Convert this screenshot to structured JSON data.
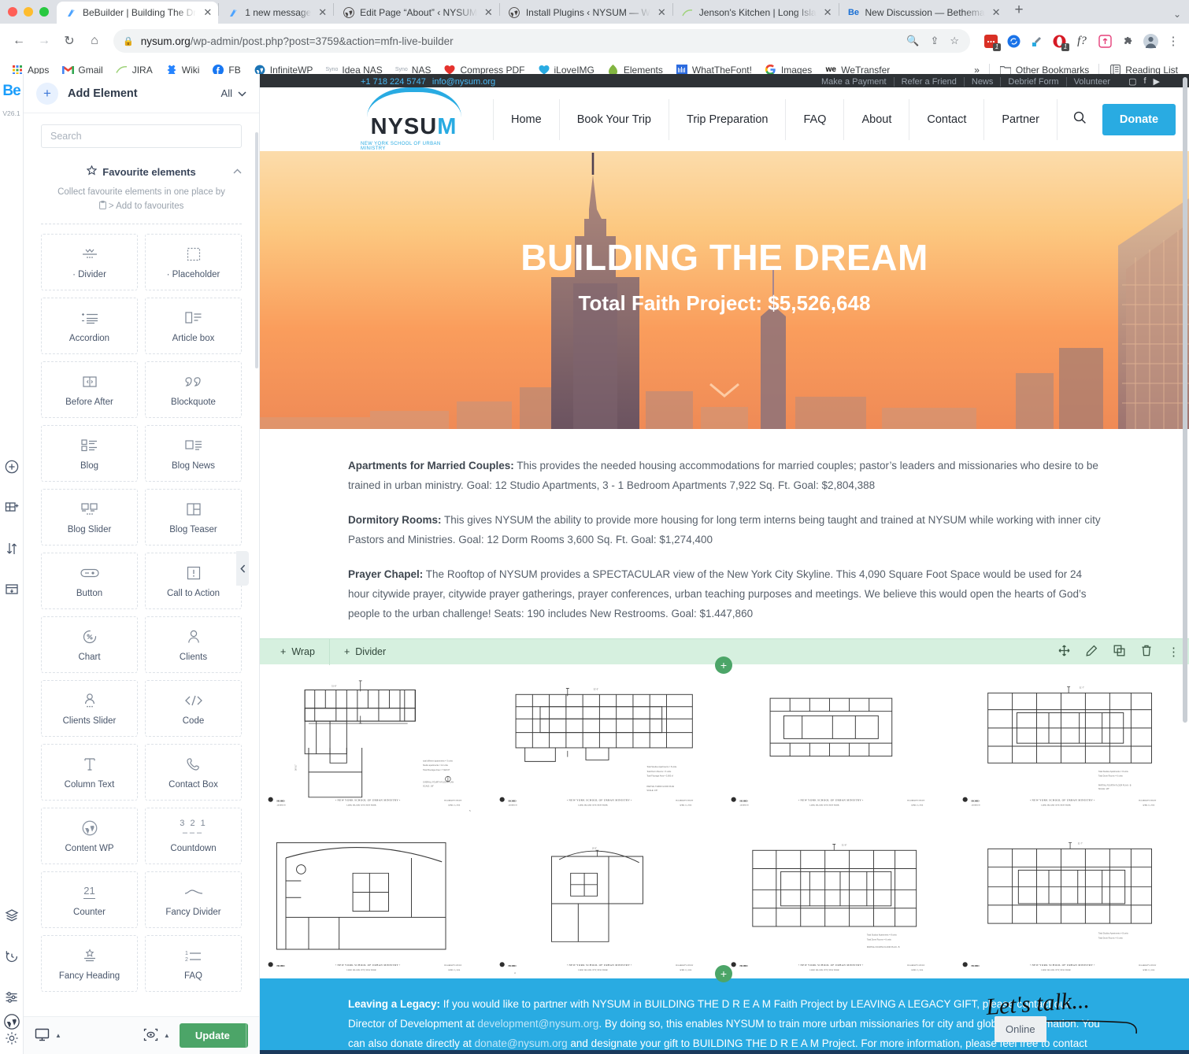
{
  "browser": {
    "tabs": [
      {
        "title": "BeBuilder | Building The Dr",
        "icon": "bebuilder-icon",
        "active": true
      },
      {
        "title": "1 new message",
        "icon": "bebuilder-icon",
        "active": false
      },
      {
        "title": "Edit Page “About” ‹ NYSUM",
        "icon": "wordpress-icon",
        "active": false
      },
      {
        "title": "Install Plugins ‹ NYSUM — W",
        "icon": "wordpress-icon",
        "active": false
      },
      {
        "title": "Jenson's Kitchen | Long Isla",
        "icon": "jira-icon",
        "active": false
      },
      {
        "title": "New Discussion — Bethema",
        "icon": "be-icon",
        "active": false
      }
    ],
    "new_tab_label": "+",
    "tab_list_chevron": "⌄",
    "url_host": "nysum.org",
    "url_path": "/wp-admin/post.php?post=3759&action=mfn-live-builder",
    "omnibox_icons": [
      "zoom-out-icon",
      "share-icon",
      "bookmark-star-icon"
    ],
    "extensions": [
      {
        "name": "screencast-extension-icon",
        "badge": "1"
      },
      {
        "name": "sync-extension-icon",
        "badge": ""
      },
      {
        "name": "eyedropper-extension-icon",
        "badge": ""
      },
      {
        "name": "opera-extension-icon",
        "badge": "1"
      },
      {
        "name": "whatthefont-extension-icon",
        "badge": ""
      },
      {
        "name": "upload-extension-icon",
        "badge": ""
      },
      {
        "name": "puzzle-extensions-icon",
        "badge": ""
      },
      {
        "name": "profile-avatar",
        "badge": ""
      },
      {
        "name": "chrome-menu-icon",
        "badge": ""
      }
    ],
    "bookmarks": [
      {
        "label": "Apps",
        "icon": "apps-grid-icon"
      },
      {
        "label": "Gmail",
        "icon": "gmail-icon"
      },
      {
        "label": "JIRA",
        "icon": "jira-icon"
      },
      {
        "label": "Wiki",
        "icon": "wiki-icon"
      },
      {
        "label": "FB",
        "icon": "facebook-icon"
      },
      {
        "label": "InfiniteWP",
        "icon": "wordpress-icon"
      },
      {
        "label": "Idea NAS",
        "icon": "synology-icon"
      },
      {
        "label": "NAS",
        "icon": "synology-icon"
      },
      {
        "label": "Compress PDF",
        "icon": "ilovepdf-icon"
      },
      {
        "label": "iLoveIMG",
        "icon": "iloveimg-icon"
      },
      {
        "label": "Elements",
        "icon": "envato-icon"
      },
      {
        "label": "WhatTheFont!",
        "icon": "whatthefont-icon"
      },
      {
        "label": "Images",
        "icon": "google-icon"
      },
      {
        "label": "WeTransfer",
        "icon": "wetransfer-icon"
      }
    ],
    "overflow_label": "»",
    "other_bookmarks": "Other Bookmarks",
    "reading_list": "Reading List"
  },
  "rail": {
    "logo": "Be",
    "version": "V26.1",
    "icons_top": [
      "add-circle-icon",
      "add-section-icon",
      "reorder-icon",
      "add-row-icon"
    ],
    "icons_bottom": [
      "layers-icon",
      "history-icon",
      "sliders-icon",
      "gear-icon"
    ],
    "wordpress_icon": "wordpress-icon"
  },
  "sidebar": {
    "add_element_label": "Add Element",
    "filter_label": "All",
    "filter_chevron": "⌄",
    "search_placeholder": "Search",
    "favourites_title": "Favourite elements",
    "favourites_desc_line1": "Collect favourite elements in one place by",
    "favourites_desc_line2": "> Add to favourites",
    "elements": [
      {
        "label": "· Divider",
        "icon": "divider-icon"
      },
      {
        "label": "· Placeholder",
        "icon": "placeholder-icon"
      },
      {
        "label": "Accordion",
        "icon": "accordion-icon"
      },
      {
        "label": "Article box",
        "icon": "article-box-icon"
      },
      {
        "label": "Before After",
        "icon": "before-after-icon"
      },
      {
        "label": "Blockquote",
        "icon": "blockquote-icon"
      },
      {
        "label": "Blog",
        "icon": "blog-icon"
      },
      {
        "label": "Blog News",
        "icon": "blog-news-icon"
      },
      {
        "label": "Blog Slider",
        "icon": "blog-slider-icon"
      },
      {
        "label": "Blog Teaser",
        "icon": "blog-teaser-icon"
      },
      {
        "label": "Button",
        "icon": "button-icon"
      },
      {
        "label": "Call to Action",
        "icon": "call-to-action-icon"
      },
      {
        "label": "Chart",
        "icon": "chart-icon"
      },
      {
        "label": "Clients",
        "icon": "clients-icon"
      },
      {
        "label": "Clients Slider",
        "icon": "clients-slider-icon"
      },
      {
        "label": "Code",
        "icon": "code-icon"
      },
      {
        "label": "Column Text",
        "icon": "column-text-icon"
      },
      {
        "label": "Contact Box",
        "icon": "contact-box-icon"
      },
      {
        "label": "Content WP",
        "icon": "wordpress-icon"
      },
      {
        "label": "Countdown",
        "icon": "countdown-icon"
      },
      {
        "label": "Counter",
        "icon": "counter-icon"
      },
      {
        "label": "Fancy Divider",
        "icon": "fancy-divider-icon"
      },
      {
        "label": "Fancy Heading",
        "icon": "fancy-heading-icon"
      },
      {
        "label": "FAQ",
        "icon": "faq-icon"
      }
    ],
    "footer": {
      "device_icon": "desktop-icon",
      "preview_icon": "preview-eye-icon",
      "update_label": "Update",
      "update_caret": "▲"
    },
    "collapse_icon": "chevron-left-icon"
  },
  "site": {
    "topbar": {
      "phone": "+1 718 224 5747",
      "email": "info@nysum.org",
      "links": [
        "Make a Payment",
        "Refer a Friend",
        "News",
        "Debrief Form",
        "Volunteer"
      ],
      "social": [
        "instagram-icon",
        "facebook-icon",
        "youtube-icon",
        "twitter-icon"
      ]
    },
    "logo_name": "NYSU",
    "logo_name_accent": "M",
    "logo_tagline": "NEW YORK SCHOOL OF URBAN MINISTRY",
    "nav": [
      "Home",
      "Book Your Trip",
      "Trip Preparation",
      "FAQ",
      "About",
      "Contact",
      "Partner"
    ],
    "search_icon": "search-icon",
    "donate_label": "Donate",
    "hero_title": "BUILDING THE DREAM",
    "hero_subtitle": "Total Faith Project: $5,526,648",
    "hero_scroll_icon": "chevron-down-icon",
    "paragraphs": [
      {
        "heading": "Apartments for Married Couples:",
        "body": "  This provides the needed housing accommodations for married couples; pastor’s leaders and missionaries who desire to be trained in urban ministry.  Goal: 12 Studio Apartments, 3 - 1 Bedroom Apartments 7,922 Sq. Ft.  Goal: $2,804,388"
      },
      {
        "heading": "Dormitory Rooms:",
        "body": "  This gives NYSUM the ability to provide more housing for long term interns being taught and trained at NYSUM while working with inner city Pastors and Ministries. Goal:  12 Dorm Rooms 3,600 Sq. Ft. Goal: $1,274,400"
      },
      {
        "heading": "Prayer Chapel:",
        "body": "  The Rooftop of NYSUM provides a SPECTACULAR view of the New York City Skyline.  This 4,090 Square Foot Space would be used for 24 hour citywide prayer, citywide prayer gatherings, prayer conferences, urban teaching purposes and meetings.  We believe this would open the hearts of God’s people to the urban challenge! Seats: 190 includes New Restrooms. Goal:  $1.447,860"
      }
    ],
    "footer": {
      "heading": "Leaving a Legacy:",
      "line1": "  If you would like to partner with NYSUM in BUILDING THE D R E A M Faith Project by LEAVING A LEGACY GIFT, please contact our Director of",
      "line2_pre": "Development at ",
      "email1": "development@nysum.org",
      "line2_post": ".  By doing so, this enables NYSUM to train more urban missionaries for city and global transformation.  You can also donate",
      "line3_pre": "directly at ",
      "email2": "donate@nysum.org",
      "line3_post": " and designate your gift to BUILDING THE D R E A M Project.  For more information, please feel free to contact ",
      "chat_label": "Let's talk...",
      "chat_status": "Online"
    }
  },
  "builder_toolbar": {
    "wrap_label": "Wrap",
    "divider_label": "Divider",
    "plus_icon": "+",
    "actions": [
      "move-icon",
      "edit-pencil-icon",
      "duplicate-icon",
      "trash-icon",
      "more-vertical-icon"
    ],
    "add_node_icon": "+"
  },
  "colors": {
    "brand_blue": "#29abe2",
    "builder_blue": "#1a9dfb",
    "update_green": "#4ca568",
    "toolbar_green": "#d6f0df",
    "dark_bar": "#2e3236"
  }
}
